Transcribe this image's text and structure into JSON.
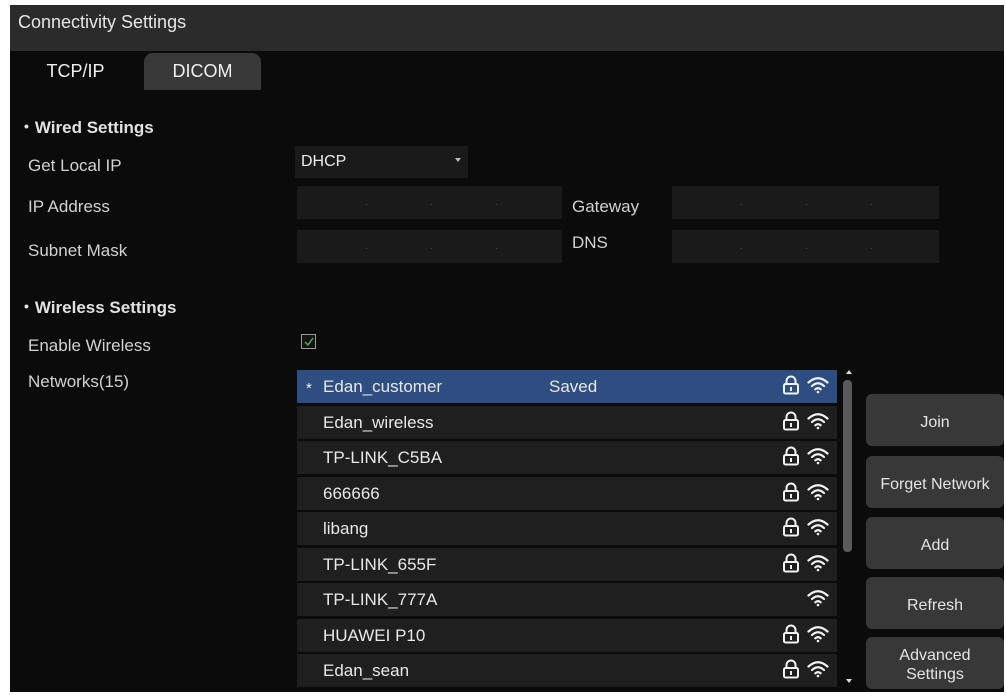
{
  "window": {
    "title": "Connectivity Settings"
  },
  "tabs": [
    {
      "label": "TCP/IP",
      "active": true
    },
    {
      "label": "DICOM",
      "active": false
    }
  ],
  "wired": {
    "heading": "Wired Settings",
    "get_local_ip_label": "Get Local IP",
    "get_local_ip_value": "DHCP",
    "ip_address_label": "IP Address",
    "subnet_mask_label": "Subnet Mask",
    "gateway_label": "Gateway",
    "dns_label": "DNS",
    "ip_separator": "."
  },
  "wireless": {
    "heading": "Wireless Settings",
    "enable_label": "Enable Wireless",
    "enabled": true,
    "networks_label": "Networks(15)"
  },
  "networks": [
    {
      "ssid": "Edan_customer",
      "starred": true,
      "status": "Saved",
      "locked": true,
      "selected": true
    },
    {
      "ssid": "Edan_wireless",
      "starred": false,
      "status": "",
      "locked": true,
      "selected": false
    },
    {
      "ssid": "TP-LINK_C5BA",
      "starred": false,
      "status": "",
      "locked": true,
      "selected": false
    },
    {
      "ssid": "666666",
      "starred": false,
      "status": "",
      "locked": true,
      "selected": false
    },
    {
      "ssid": "libang",
      "starred": false,
      "status": "",
      "locked": true,
      "selected": false
    },
    {
      "ssid": "TP-LINK_655F",
      "starred": false,
      "status": "",
      "locked": true,
      "selected": false
    },
    {
      "ssid": "TP-LINK_777A",
      "starred": false,
      "status": "",
      "locked": false,
      "selected": false
    },
    {
      "ssid": "HUAWEI P10",
      "starred": false,
      "status": "",
      "locked": true,
      "selected": false
    },
    {
      "ssid": "Edan_sean",
      "starred": false,
      "status": "",
      "locked": true,
      "selected": false
    }
  ],
  "buttons": {
    "join": "Join",
    "forget": "Forget Network",
    "add": "Add",
    "refresh": "Refresh",
    "advanced_line1": "Advanced",
    "advanced_line2": "Settings"
  },
  "colors": {
    "selected_row": "#2e4d80",
    "background": "#0b0b0b",
    "button": "#383838",
    "checkmark": "#4caf50"
  },
  "icons": {
    "lock": "padlock-icon",
    "wifi": "wifi-signal-icon",
    "check": "checkmark-icon",
    "dropdown": "caret-down-icon"
  }
}
